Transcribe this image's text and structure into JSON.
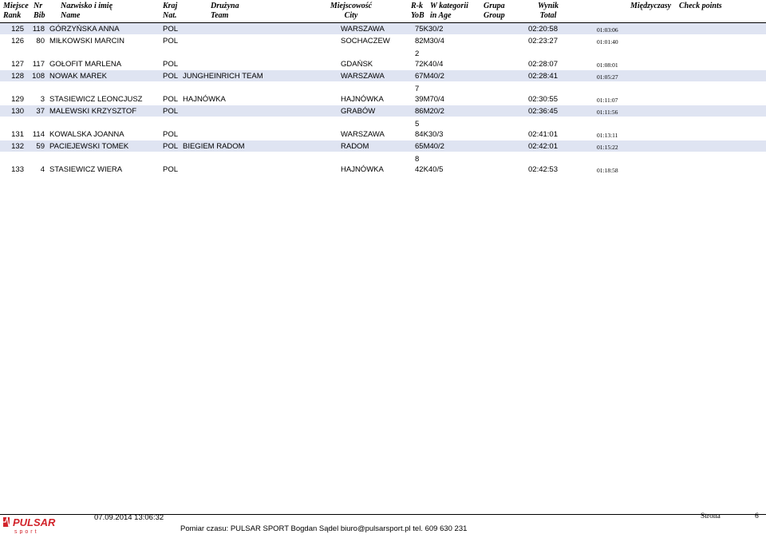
{
  "header": {
    "columns": [
      {
        "l1": "Miejsce",
        "l2": "Rank"
      },
      {
        "l1": "Nr",
        "l2": "Bib"
      },
      {
        "l1": "Nazwisko i imię",
        "l2": "Name"
      },
      {
        "l1": "Kraj",
        "l2": "Nat."
      },
      {
        "l1": "Drużyna",
        "l2": "Team"
      },
      {
        "l1": "Miejscowość",
        "l2": "City"
      },
      {
        "l1": "R-k",
        "l2": "YoB"
      },
      {
        "l1": "W kategorii",
        "l2": "in Age"
      },
      {
        "l1": "Grupa",
        "l2": "Group"
      },
      {
        "l1": "Wynik",
        "l2": "Total"
      },
      {
        "l1": "Międzyczasy",
        "l2": ""
      },
      {
        "l1": "Check points",
        "l2": ""
      }
    ]
  },
  "rows": [
    {
      "rank": "125",
      "bib": "118",
      "name": "GÓRZYŃSKA ANNA",
      "nat": "POL",
      "team": "",
      "city": "WARSZAWA",
      "cat": "75K30/2",
      "total": "02:20:58",
      "split": "01:03:06",
      "shaded": true
    },
    {
      "rank": "126",
      "bib": "80",
      "name": "MIŁKOWSKI MARCIN",
      "nat": "POL",
      "team": "",
      "city": "SOCHACZEW",
      "cat": "82M30/4",
      "total": "02:23:27",
      "split": "01:01:40",
      "shaded": false
    },
    {
      "rank": "127",
      "bib": "117",
      "name": "GOŁOFIT MARLENA",
      "nat": "POL",
      "team": "",
      "city": "GDAŃSK",
      "cat": "72K40/4",
      "total": "02:28:07",
      "split": "01:08:01",
      "shaded": false
    },
    {
      "rank": "128",
      "bib": "108",
      "name": "NOWAK MAREK",
      "nat": "POL",
      "team": "JUNGHEINRICH TEAM",
      "city": "WARSZAWA",
      "cat": "67M40/2",
      "total": "02:28:41",
      "split": "01:05:27",
      "shaded": true
    },
    {
      "rank": "129",
      "bib": "3",
      "name": "STASIEWICZ LEONCJUSZ",
      "nat": "POL",
      "team": "HAJNÓWKA",
      "city": "HAJNÓWKA",
      "cat": "39M70/4",
      "total": "02:30:55",
      "split": "01:11:07",
      "shaded": false
    },
    {
      "rank": "130",
      "bib": "37",
      "name": "MALEWSKI KRZYSZTOF",
      "nat": "POL",
      "team": "",
      "city": "GRABÓW",
      "cat": "86M20/2",
      "total": "02:36:45",
      "split": "01:11:56",
      "shaded": true
    },
    {
      "rank": "131",
      "bib": "114",
      "name": "KOWALSKA JOANNA",
      "nat": "POL",
      "team": "",
      "city": "WARSZAWA",
      "cat": "84K30/3",
      "total": "02:41:01",
      "split": "01:13:11",
      "shaded": false
    },
    {
      "rank": "132",
      "bib": "59",
      "name": "PACIEJEWSKI TOMEK",
      "nat": "POL",
      "team": "BIEGIEM RADOM",
      "city": "RADOM",
      "cat": "65M40/2",
      "total": "02:42:01",
      "split": "01:15:22",
      "shaded": true
    },
    {
      "rank": "133",
      "bib": "4",
      "name": "STASIEWICZ WIERA",
      "nat": "POL",
      "team": "",
      "city": "HAJNÓWKA",
      "cat": "42K40/5",
      "total": "02:42:53",
      "split": "01:18:58",
      "shaded": false
    }
  ],
  "stray_digits": [
    "2",
    "7",
    "5",
    "8"
  ],
  "footer": {
    "timestamp": "07.09.2014 13:06:32",
    "credits": "Pomiar czasu: PULSAR SPORT Bogdan Sądel biuro@pulsarsport.pl tel. 609 630 231",
    "page_label": "Strona",
    "page_number": "6",
    "logo_text": "PULSAR",
    "logo_sub": "sport"
  },
  "colors": {
    "row_shade": "#dfe4f2",
    "logo_red": "#d2232a"
  }
}
